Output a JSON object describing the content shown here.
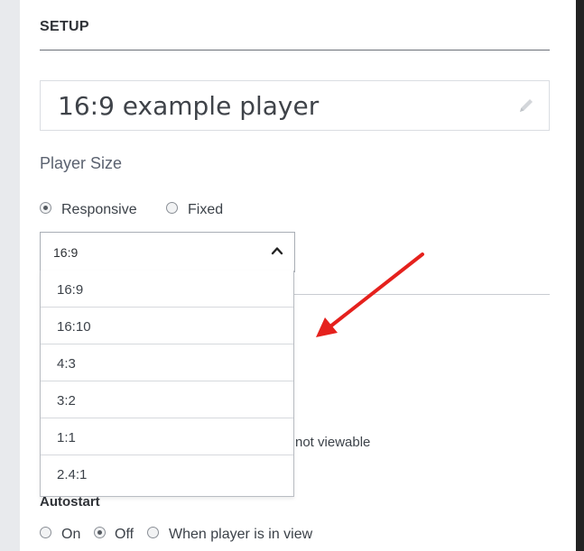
{
  "setup": {
    "title": "SETUP",
    "player_name": "16:9 example player"
  },
  "player_size": {
    "label": "Player Size",
    "options": [
      {
        "label": "Responsive",
        "checked": true
      },
      {
        "label": "Fixed",
        "checked": false
      }
    ],
    "aspect_select": {
      "selected": "16:9",
      "options": [
        "16:9",
        "16:10",
        "4:3",
        "3:2",
        "1:1",
        "2.4:1"
      ]
    }
  },
  "partially_hidden_text": "not viewable",
  "autostart": {
    "label": "Autostart",
    "options": [
      {
        "label": "On",
        "checked": false
      },
      {
        "label": "Off",
        "checked": true
      },
      {
        "label": "When player is in view",
        "checked": false
      }
    ]
  },
  "annotation": {
    "arrow_color": "#e5211d"
  }
}
